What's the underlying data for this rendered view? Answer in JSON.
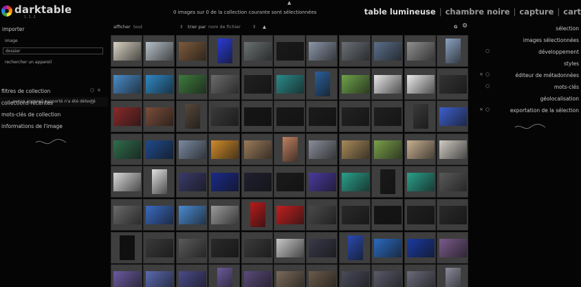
{
  "app": {
    "name": "darktable",
    "version": "1.1.2"
  },
  "top": {
    "status": "0 images sur 0 de la collection courante sont sélectionnées",
    "views": [
      {
        "label": "table lumineuse",
        "active": true
      },
      {
        "label": "chambre noire",
        "active": false
      },
      {
        "label": "capture",
        "active": false
      },
      {
        "label": "cart",
        "active": false
      }
    ],
    "separator": "|"
  },
  "left": {
    "import_title": "importer",
    "import_items": [
      "image",
      "dossier",
      "rechercher un appareil"
    ],
    "no_device": "aucun appareil supporté n'a été détecté",
    "modules": [
      "filtres de collection",
      "collections récentes",
      "mots-clés de collection",
      "informations de l'image"
    ]
  },
  "filterbar": {
    "show_label": "afficher",
    "show_value": "tout",
    "sort_label": "trier par",
    "sort_value": "nom de fichier",
    "sort_arrow": "▲",
    "group_label": "G",
    "settings_glyph": "⚙"
  },
  "right": {
    "modules": [
      "sélection",
      "images sélectionnées",
      "développement",
      "styles",
      "éditeur de métadonnées",
      "mots-clés",
      "géolocalisation",
      "exportation de la sélection"
    ]
  },
  "colors": {
    "accent": "#dcdcdc",
    "panel": "#050505",
    "cell": "#3e3e3e"
  },
  "grid": {
    "rows": 8,
    "cols": 11,
    "thumbs": [
      [
        "#d9d2c3",
        "#b7c1c9",
        "#7d5a3c",
        "#2a3bd6",
        "#6a7072",
        "#1a1a1a",
        "#8b96a8",
        "#6b7077",
        "#5b6f8a",
        "#8f8f8f",
        "#8ca3c2"
      ],
      [
        "#4a8cc9",
        "#2f88c4",
        "#3e7a3e",
        "#6b6b6b",
        "#202020",
        "#2c8a8a",
        "#2a5f9a",
        "#6ea34a",
        "#e7e7e7",
        "#eaeaea",
        "#333333"
      ],
      [
        "#8a2a2a",
        "#7a4e3a",
        "#56483a",
        "#3a3a3a",
        "#151515",
        "#181818",
        "#1b1b1b",
        "#222222",
        "#202020",
        "#3a3a3a",
        "#3d5fcc"
      ],
      [
        "#2f6c4c",
        "#1f4a8a",
        "#7a8aa0",
        "#d08a2a",
        "#9a7a5a",
        "#c08060",
        "#8a8e9a",
        "#a88a5a",
        "#7aa04a",
        "#c8b090",
        "#d0ccc4"
      ],
      [
        "#d8d8d8",
        "#e0e0e0",
        "#3a3a6a",
        "#1a2a8a",
        "#202030",
        "#1a1a1a",
        "#4a3aa0",
        "#2aa08a",
        "#1a1a1a",
        "#2aa08a",
        "#5a5a5a"
      ],
      [
        "#6a6a6a",
        "#3a6ac0",
        "#4a8ad0",
        "#9a9a9a",
        "#b81a1a",
        "#c02020",
        "#4a4a4a",
        "#2a2a2a",
        "#151515",
        "#202020",
        "#2a2a2a"
      ],
      [
        "#0f0f0f",
        "#3a3a3a",
        "#5a5a5a",
        "#2a2a2a",
        "#3a3a3a",
        "#c8c8c8",
        "#3a3a4a",
        "#2a4ab0",
        "#2a6ac0",
        "#1a3aa0",
        "#7a5a8a"
      ],
      [
        "#6a5aa0",
        "#5a6ab0",
        "#4a4a8a",
        "#6a5a9a",
        "#5a4a7a",
        "#7a6a5a",
        "#6a5a4a",
        "#4a4a5a",
        "#5a5a6a",
        "#6a6a7a",
        "#8a8a9a"
      ]
    ]
  }
}
